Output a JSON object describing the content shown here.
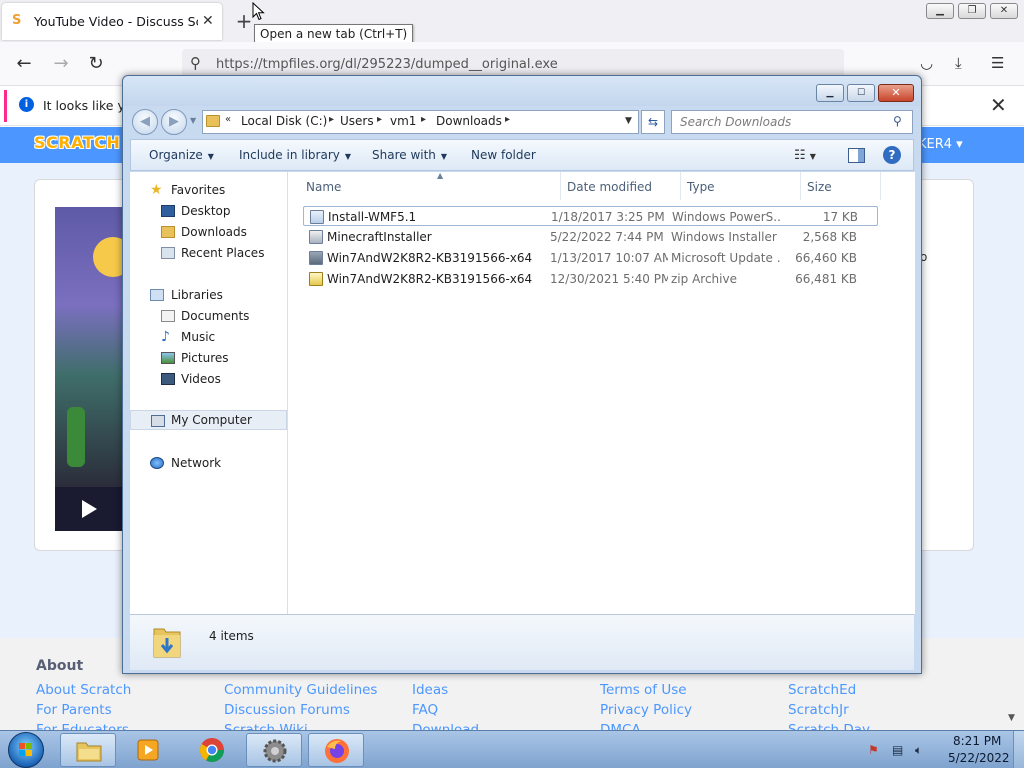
{
  "browser": {
    "tab_title": "YouTube Video - Discuss Scratch",
    "newtab_tooltip": "Open a new tab (Ctrl+T)",
    "url": "https://tmpfiles.org/dl/295223/dumped__original.exe",
    "infobar_text": "It looks like you"
  },
  "scratch": {
    "logo": "SCRATCH",
    "user_fragment": "KER4 ▾",
    "card_fragment": "o",
    "footer_heading": "About",
    "footer_links": [
      [
        "About Scratch",
        "For Parents",
        "For Educators"
      ],
      [
        "Community Guidelines",
        "Discussion Forums",
        "Scratch Wiki"
      ],
      [
        "Ideas",
        "FAQ",
        "Download"
      ],
      [
        "Terms of Use",
        "Privacy Policy",
        "DMCA"
      ],
      [
        "ScratchEd",
        "ScratchJr",
        "Scratch Day"
      ]
    ]
  },
  "explorer": {
    "breadcrumb": [
      "Local Disk (C:)",
      "Users",
      "vm1",
      "Downloads"
    ],
    "search_placeholder": "Search Downloads",
    "commands": [
      "Organize",
      "Include in library",
      "Share with",
      "New folder"
    ],
    "nav": {
      "favorites_label": "Favorites",
      "favorites": [
        "Desktop",
        "Downloads",
        "Recent Places"
      ],
      "libraries_label": "Libraries",
      "libraries": [
        "Documents",
        "Music",
        "Pictures",
        "Videos"
      ],
      "computer": "My Computer",
      "network": "Network"
    },
    "columns": [
      "Name",
      "Date modified",
      "Type",
      "Size"
    ],
    "files": [
      {
        "name": "Install-WMF5.1",
        "date": "1/18/2017 3:25 PM",
        "type": "Windows PowerS...",
        "size": "17 KB"
      },
      {
        "name": "MinecraftInstaller",
        "date": "5/22/2022 7:44 PM",
        "type": "Windows Installer ...",
        "size": "2,568 KB"
      },
      {
        "name": "Win7AndW2K8R2-KB3191566-x64",
        "date": "1/13/2017 10:07 AM",
        "type": "Microsoft Update ...",
        "size": "66,460 KB"
      },
      {
        "name": "Win7AndW2K8R2-KB3191566-x64",
        "date": "12/30/2021 5:40 PM",
        "type": "zip Archive",
        "size": "66,481 KB"
      }
    ],
    "items_count": "4 items"
  },
  "taskbar": {
    "time": "8:21 PM",
    "date": "5/22/2022"
  },
  "colors": {
    "scratch_blue": "#4c97ff",
    "explorer_frame": "#c7daf0",
    "taskbar": "#8fb1da"
  }
}
